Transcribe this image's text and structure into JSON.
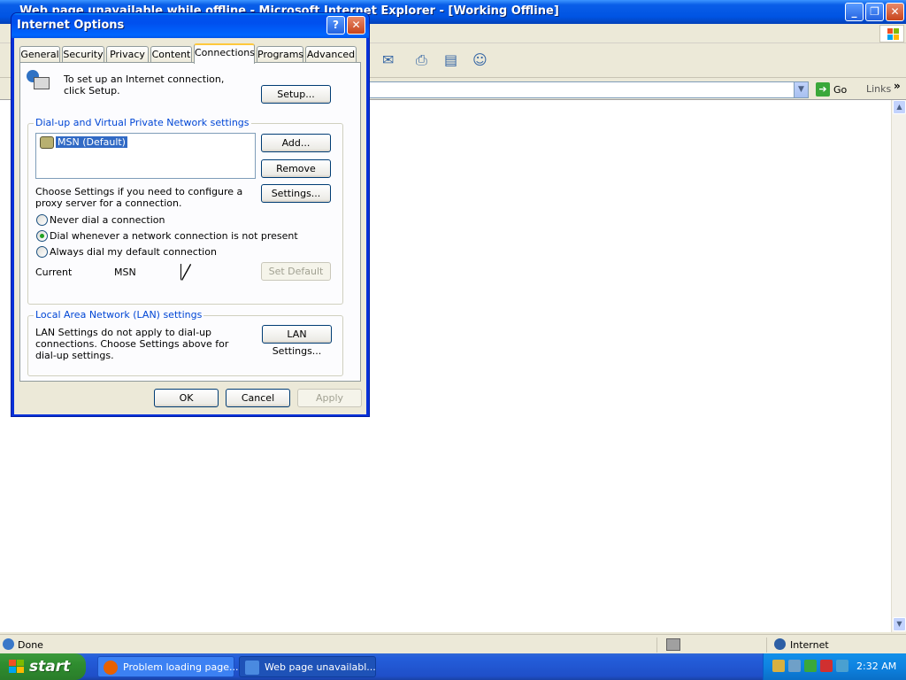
{
  "browser": {
    "title": "Web page unavailable while offline - Microsoft Internet Explorer - [Working Offline]",
    "go_label": "Go",
    "links_label": "Links",
    "chevron": "»",
    "status_text": "Done",
    "zone_text": "Internet"
  },
  "dialog": {
    "title": "Internet Options",
    "help_glyph": "?",
    "close_glyph": "✕",
    "tabs": [
      "General",
      "Security",
      "Privacy",
      "Content",
      "Connections",
      "Programs",
      "Advanced"
    ],
    "active_tab": "Connections",
    "setup_text": "To set up an Internet connection, click Setup.",
    "setup_button": "Setup...",
    "dialup_group_label": "Dial-up and Virtual Private Network settings",
    "connections": [
      "MSN (Default)"
    ],
    "add_button": "Add...",
    "remove_button": "Remove",
    "proxy_text": "Choose Settings if you need to configure a proxy server for a connection.",
    "settings_button": "Settings...",
    "radios": [
      {
        "label": "Never dial a connection",
        "checked": false
      },
      {
        "label": "Dial whenever a network connection is not present",
        "checked": true
      },
      {
        "label": "Always dial my default connection",
        "checked": false
      }
    ],
    "current_label": "Current",
    "current_value": "MSN",
    "set_default_button": "Set Default",
    "lan_group_label": "Local Area Network (LAN) settings",
    "lan_text": "LAN Settings do not apply to dial-up connections. Choose Settings above for dial-up settings.",
    "lan_button": "LAN Settings...",
    "ok_button": "OK",
    "cancel_button": "Cancel",
    "apply_button": "Apply"
  },
  "taskbar": {
    "start_label": "start",
    "tasks": [
      "Problem loading page...",
      "Web page unavailabl..."
    ],
    "clock": "2:32 AM"
  }
}
